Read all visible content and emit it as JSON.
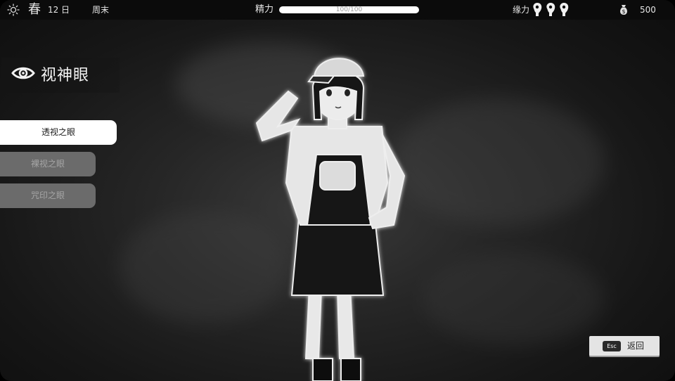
{
  "topbar": {
    "season": "春",
    "day_number": "12",
    "day_unit": "日",
    "weekday": "周末",
    "stamina_label": "精力",
    "stamina_text": "100/100",
    "stamina_fraction": 1.0,
    "affinity_label": "缘力",
    "affinity_tokens": 3,
    "money": "500"
  },
  "panel": {
    "title": "视神眼"
  },
  "menu": {
    "items": [
      {
        "label": "透视之眼",
        "state": "selected"
      },
      {
        "label": "裸视之眼",
        "state": "disabled"
      },
      {
        "label": "咒印之眼",
        "state": "disabled"
      }
    ]
  },
  "footer": {
    "esc_key": "Esc",
    "back_label": "返回"
  },
  "icons": {
    "weather": "sun-icon",
    "title": "eye-icon",
    "affinity": "hand-token-icon",
    "money": "money-bag-icon"
  },
  "colors": {
    "selected_button": "#ffffff",
    "disabled_button": "#6b6b6b",
    "topbar_bg": "#0b0b0b"
  }
}
